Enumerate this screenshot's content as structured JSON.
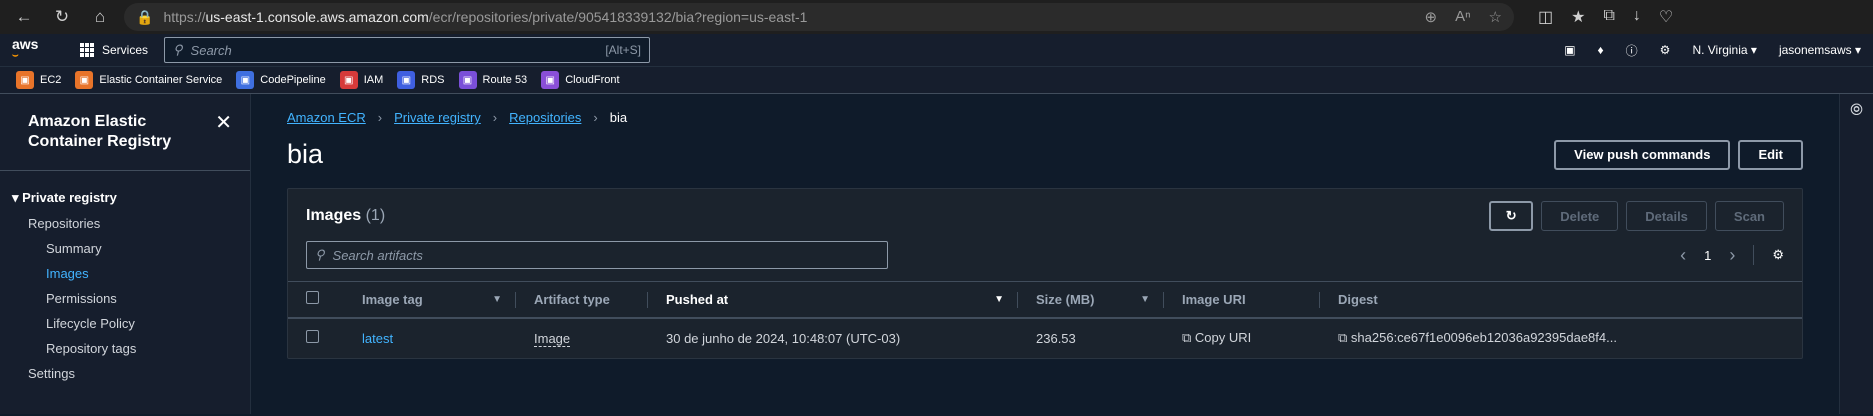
{
  "browser": {
    "url_prefix": "https://",
    "url_host": "us-east-1.console.aws.amazon.com",
    "url_path": "/ecr/repositories/private/905418339132/bia?region=us-east-1"
  },
  "awsnav": {
    "logo": "aws",
    "services_label": "Services",
    "search_placeholder": "Search",
    "search_shortcut": "[Alt+S]",
    "region": "N. Virginia",
    "account": "jasonemsaws"
  },
  "favorites": [
    {
      "label": "EC2",
      "color": "#e8742a"
    },
    {
      "label": "Elastic Container Service",
      "color": "#e8742a"
    },
    {
      "label": "CodePipeline",
      "color": "#3f6fe0"
    },
    {
      "label": "IAM",
      "color": "#d63a3a"
    },
    {
      "label": "RDS",
      "color": "#3f5fe0"
    },
    {
      "label": "Route 53",
      "color": "#7a4fd8"
    },
    {
      "label": "CloudFront",
      "color": "#8a4fd8"
    }
  ],
  "sidebar": {
    "title": "Amazon Elastic Container Registry",
    "group": "Private registry",
    "items": [
      {
        "label": "Repositories"
      },
      {
        "label": "Summary"
      },
      {
        "label": "Images"
      },
      {
        "label": "Permissions"
      },
      {
        "label": "Lifecycle Policy"
      },
      {
        "label": "Repository tags"
      },
      {
        "label": "Settings"
      }
    ]
  },
  "breadcrumbs": [
    "Amazon ECR",
    "Private registry",
    "Repositories",
    "bia"
  ],
  "page": {
    "title": "bia",
    "view_push_label": "View push commands",
    "edit_label": "Edit"
  },
  "images": {
    "title": "Images",
    "count": "(1)",
    "delete_label": "Delete",
    "details_label": "Details",
    "scan_label": "Scan",
    "filter_placeholder": "Search artifacts",
    "page_number": "1",
    "columns": [
      "Image tag",
      "Artifact type",
      "Pushed at",
      "Size (MB)",
      "Image URI",
      "Digest"
    ],
    "rows": [
      {
        "tag": "latest",
        "artifact_type": "Image",
        "pushed_at": "30 de junho de 2024, 10:48:07 (UTC-03)",
        "size": "236.53",
        "uri": "Copy URI",
        "digest": "sha256:ce67f1e0096eb12036a92395dae8f4..."
      }
    ]
  },
  "colors": {
    "link": "#42b4ff",
    "background": "#0f1b2a",
    "brand": "#ff9900"
  }
}
